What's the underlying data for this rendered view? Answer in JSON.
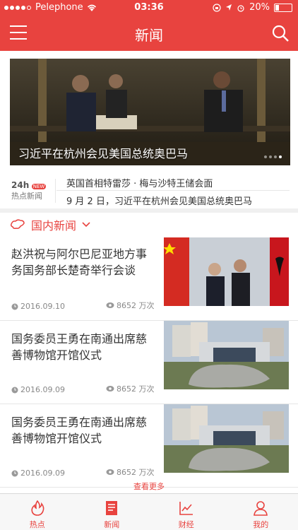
{
  "status_bar": {
    "carrier": "Pelephone",
    "time": "03:36",
    "battery": "20%"
  },
  "header": {
    "title": "新闻"
  },
  "hero": {
    "caption": "习近平在杭州会见美国总统奥巴马",
    "slide_count": 4,
    "active_slide": 4
  },
  "ticker": {
    "badge_top": "24h",
    "badge_new": "NEW",
    "badge_bottom": "热点新闻",
    "items": [
      "英国首相特雷莎 · 梅与沙特王储会面",
      "9 月 2 日，习近平在杭州会见美国总统奥巴马"
    ]
  },
  "section": {
    "title": "国内新闻"
  },
  "news": [
    {
      "title": "赵洪祝与阿尔巴尼亚地方事务国务部长楚奇举行会谈",
      "date": "2016.09.10",
      "views": "8652 万次"
    },
    {
      "title": "国务委员王勇在南通出席慈善博物馆开馆仪式",
      "date": "2016.09.09",
      "views": "8652 万次"
    },
    {
      "title": "国务委员王勇在南通出席慈善博物馆开馆仪式",
      "date": "2016.09.09",
      "views": "8652 万次"
    }
  ],
  "more_label": "查看更多",
  "tabs": [
    {
      "label": "热点",
      "icon": "flame-icon"
    },
    {
      "label": "新闻",
      "icon": "document-icon"
    },
    {
      "label": "财经",
      "icon": "chart-icon"
    },
    {
      "label": "我的",
      "icon": "user-icon"
    }
  ],
  "colors": {
    "brand": "#e8433f"
  }
}
